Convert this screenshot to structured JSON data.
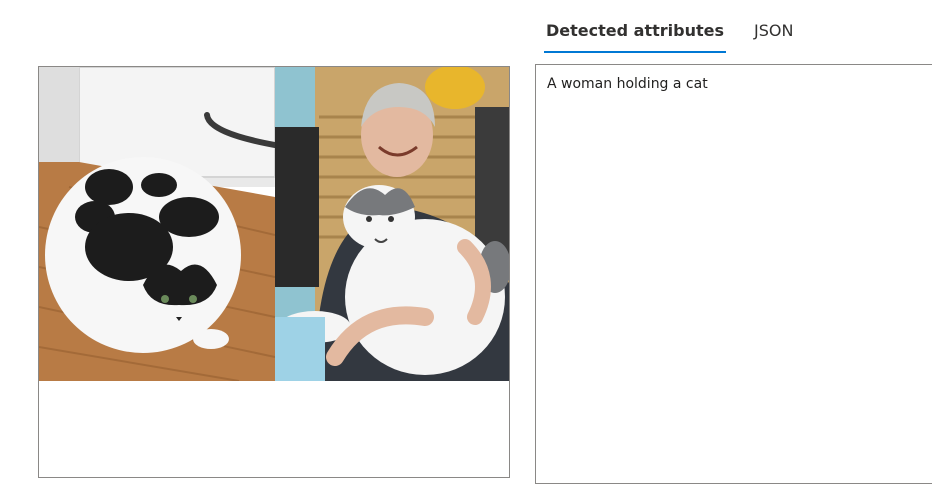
{
  "tabs": [
    {
      "label": "Detected attributes",
      "active": true
    },
    {
      "label": "JSON",
      "active": false
    }
  ],
  "result": {
    "caption": "A woman holding a cat"
  },
  "colors": {
    "accent": "#0078d4",
    "border": "#8a8886"
  }
}
